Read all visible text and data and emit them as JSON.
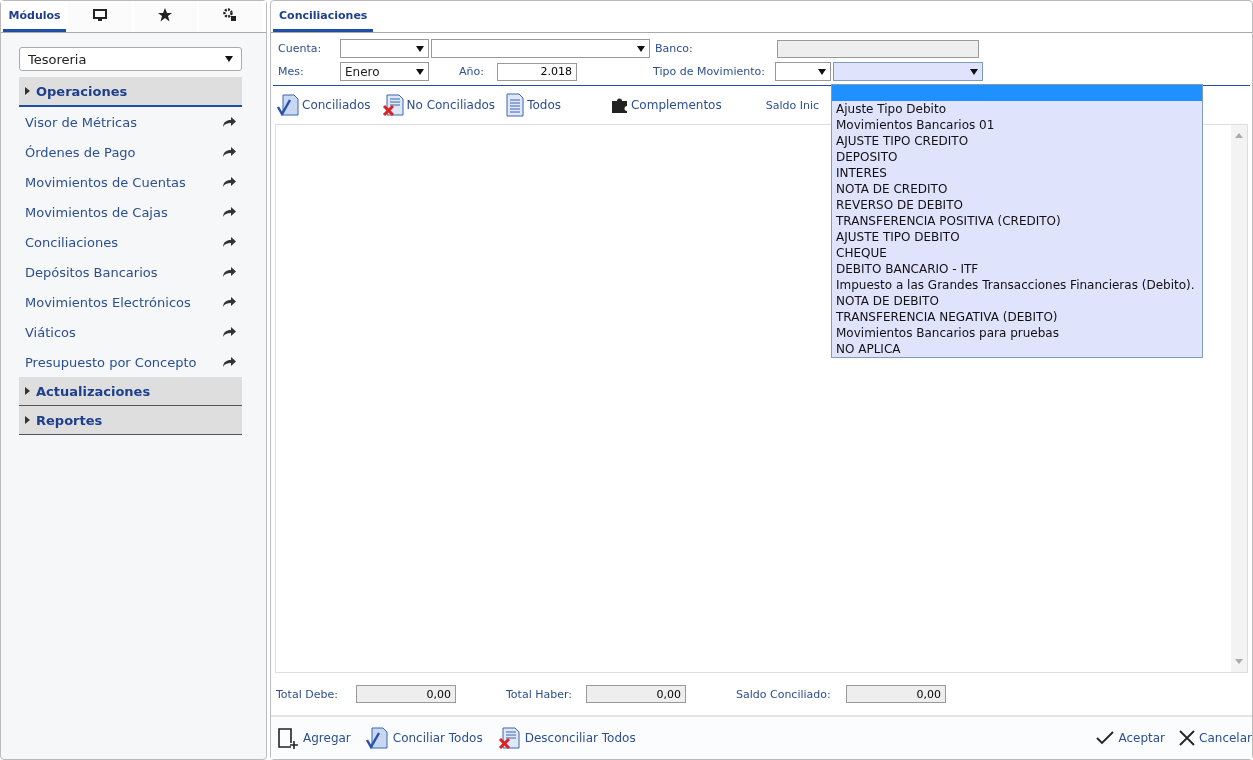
{
  "sidebar": {
    "tabs": [
      {
        "kind": "text",
        "label": "Módulos",
        "selected": true
      },
      {
        "kind": "monitor",
        "selected": false
      },
      {
        "kind": "star",
        "selected": false
      },
      {
        "kind": "gears",
        "selected": false
      }
    ],
    "module_select": {
      "value": "Tesoreria"
    },
    "sections": [
      {
        "title": "Operaciones",
        "expanded": true,
        "items": [
          "Visor de Métricas",
          "Órdenes de Pago",
          "Movimientos de Cuentas",
          "Movimientos de Cajas",
          "Conciliaciones",
          "Depósitos Bancarios",
          "Movimientos Electrónicos",
          "Viáticos",
          "Presupuesto por Concepto"
        ]
      },
      {
        "title": "Actualizaciones",
        "expanded": false
      },
      {
        "title": "Reportes",
        "expanded": false
      }
    ]
  },
  "main": {
    "tabs": [
      {
        "label": "Conciliaciones",
        "selected": true
      }
    ],
    "filters": {
      "cuenta_label": "Cuenta:",
      "banco_label": "Banco:",
      "mes_label": "Mes:",
      "mes_value": "Enero",
      "anio_label": "Año:",
      "anio_value": "2.018",
      "tipo_label": "Tipo de Movimiento:"
    },
    "toolbar": [
      {
        "kind": "check",
        "label": "Conciliados"
      },
      {
        "kind": "cross",
        "label": "No Conciliados"
      },
      {
        "kind": "doc",
        "label": "Todos"
      },
      {
        "kind": "puzzle",
        "label": "Complementos"
      },
      {
        "kind": "text",
        "label": "Saldo Inic"
      }
    ],
    "tipo_dropdown": {
      "expanded": true,
      "blank_option_selected": true,
      "options": [
        "Ajuste Tipo Debito",
        "Movimientos Bancarios 01",
        "AJUSTE TIPO CREDITO",
        "DEPOSITO",
        "INTERES",
        "NOTA DE CREDITO",
        "REVERSO DE DEBITO",
        "TRANSFERENCIA POSITIVA (CREDITO)",
        "AJUSTE TIPO DEBITO",
        "CHEQUE",
        "DEBITO BANCARIO - ITF",
        "Impuesto a las Grandes Transacciones Financieras (Debito).",
        "NOTA DE DEBITO",
        "TRANSFERENCIA NEGATIVA (DEBITO)",
        "Movimientos Bancarios para pruebas",
        "NO APLICA"
      ]
    },
    "totals": [
      {
        "label": "Total Debe:",
        "value": "0,00"
      },
      {
        "label": "Total Haber:",
        "value": "0,00"
      },
      {
        "label": "Saldo Conciliado:",
        "value": "0,00"
      }
    ],
    "footer_left": [
      {
        "kind": "add",
        "label": "Agregar"
      },
      {
        "kind": "check",
        "label": "Conciliar Todos"
      },
      {
        "kind": "cross",
        "label": "Desconciliar Todos"
      }
    ],
    "footer_right": [
      {
        "kind": "tick",
        "label": "Aceptar"
      },
      {
        "kind": "close",
        "label": "Cancelar"
      }
    ]
  }
}
